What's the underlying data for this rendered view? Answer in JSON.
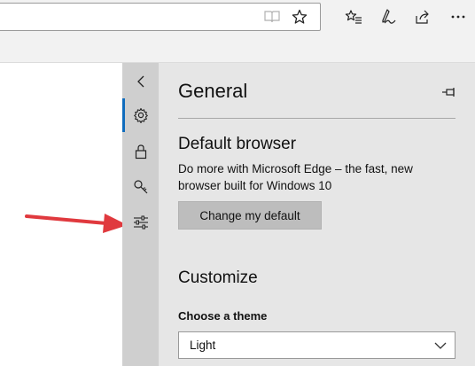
{
  "toolbar": {
    "icons": [
      "reading-view-icon",
      "favorite-star-icon",
      "favorites-hub-icon",
      "web-note-pen-icon",
      "share-icon",
      "more-ellipsis-icon"
    ]
  },
  "settings_rail": {
    "items": [
      "back-chevron-icon",
      "settings-gear-icon",
      "privacy-lock-icon",
      "passwords-key-icon",
      "advanced-sliders-icon"
    ],
    "active": "settings-gear-icon"
  },
  "panel": {
    "title": "General",
    "default_browser": {
      "heading": "Default browser",
      "description": "Do more with Microsoft Edge – the fast, new browser built for Windows 10",
      "button": "Change my default"
    },
    "customize": {
      "heading": "Customize",
      "theme_label": "Choose a theme",
      "theme_value": "Light"
    }
  },
  "colors": {
    "annotation_arrow": "#e0393e",
    "active_indicator": "#0f6cbd",
    "panel_bg": "#e6e6e6",
    "rail_bg": "#cfcfcf"
  }
}
